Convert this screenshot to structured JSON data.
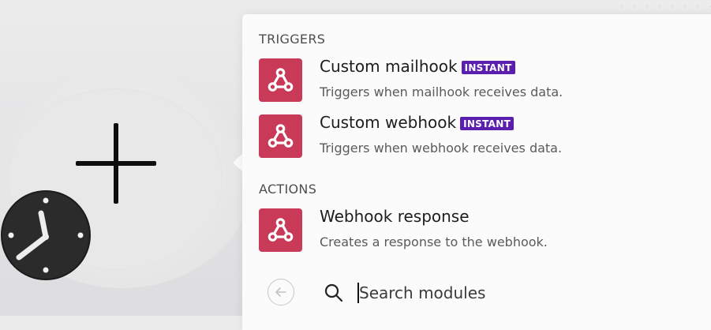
{
  "panel": {
    "triggers_label": "TRIGGERS",
    "actions_label": "ACTIONS",
    "triggers": [
      {
        "title": "Custom mailhook",
        "badge": "INSTANT",
        "description": "Triggers when mailhook receives data.",
        "icon": "webhook-icon"
      },
      {
        "title": "Custom webhook",
        "badge": "INSTANT",
        "description": "Triggers when webhook receives data.",
        "icon": "webhook-icon"
      }
    ],
    "actions": [
      {
        "title": "Webhook response",
        "description": "Creates a response to the webhook.",
        "icon": "webhook-icon"
      }
    ]
  },
  "search": {
    "placeholder": "Search modules"
  },
  "colors": {
    "module_icon_bg": "#c83a57",
    "badge_bg": "#5b1fb0",
    "panel_bg": "#fbfbfb"
  },
  "icons": {
    "add": "plus-icon",
    "schedule": "clock-icon",
    "back": "arrow-left-circle-icon",
    "search": "search-icon"
  }
}
